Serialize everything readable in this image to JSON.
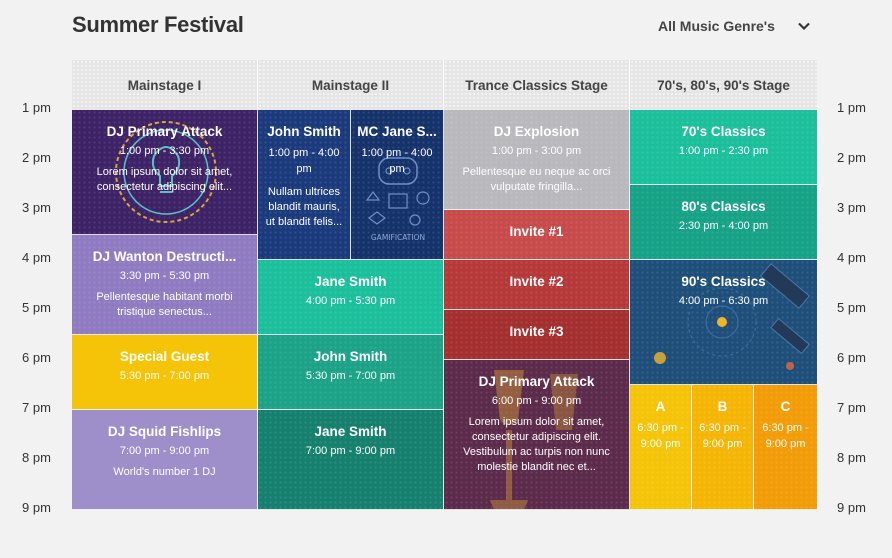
{
  "header": {
    "title": "Summer Festival",
    "genre_filter": "All Music Genre's"
  },
  "times": [
    "1 pm",
    "2 pm",
    "3 pm",
    "4 pm",
    "5 pm",
    "6 pm",
    "7 pm",
    "8 pm",
    "9 pm"
  ],
  "stages": [
    "Mainstage I",
    "Mainstage II",
    "Trance Classics Stage",
    "70's, 80's, 90's Stage"
  ],
  "events": [
    {
      "name": "DJ Primary Attack",
      "time": "1:00 pm - 3:30 pm",
      "desc": "Lorem ipsum dolor sit amet, consectetur adipiscing elit...",
      "color": "#3d2266"
    },
    {
      "name": "DJ Wanton Destructi...",
      "time": "3:30 pm - 5:30 pm",
      "desc": "Pellentesque habitant morbi tristique senectus...",
      "color": "#8e7bc2"
    },
    {
      "name": "Special Guest",
      "time": "5:30 pm - 7:00 pm",
      "desc": "",
      "color": "#f5c408"
    },
    {
      "name": "DJ Squid Fishlips",
      "time": "7:00 pm - 9:00 pm",
      "desc": "World's number 1 DJ",
      "color": "#9e8fcb"
    },
    {
      "name": "John Smith",
      "time": "1:00 pm - 4:00 pm",
      "desc": "Nullam ultrices blandit mauris, ut blandit felis...",
      "color": "#1b3a7c"
    },
    {
      "name": "MC Jane S...",
      "time": "1:00 pm - 4:00 pm",
      "desc": "",
      "color": "#16326b"
    },
    {
      "name": "Jane Smith",
      "time": "4:00 pm - 5:30 pm",
      "desc": "",
      "color": "#1bbf9b"
    },
    {
      "name": "John Smith",
      "time": "5:30 pm - 7:00 pm",
      "desc": "",
      "color": "#1ba287"
    },
    {
      "name": "Jane Smith",
      "time": "7:00 pm - 9:00 pm",
      "desc": "",
      "color": "#16806e"
    },
    {
      "name": "DJ Explosion",
      "time": "1:00 pm - 3:00 pm",
      "desc": "Pellentesque eu neque ac orci vulputate fringilla...",
      "color": "#b9b9bd"
    },
    {
      "name": "Invite #1",
      "time": "",
      "desc": "",
      "color": "#c74b4b"
    },
    {
      "name": "Invite #2",
      "time": "",
      "desc": "",
      "color": "#b63939"
    },
    {
      "name": "Invite #3",
      "time": "",
      "desc": "",
      "color": "#a42f2f"
    },
    {
      "name": "DJ Primary Attack",
      "time": "6:00 pm - 9:00 pm",
      "desc": "Lorem ipsum dolor sit amet, consectetur adipiscing elit. Vestibulum ac turpis non nunc molestie blandit nec et...",
      "color": "#5c2a4a"
    },
    {
      "name": "70's Classics",
      "time": "1:00 pm - 2:30 pm",
      "desc": "",
      "color": "#1bbf9b"
    },
    {
      "name": "80's Classics",
      "time": "2:30 pm - 4:00 pm",
      "desc": "",
      "color": "#16a286"
    },
    {
      "name": "90's Classics",
      "time": "4:00 pm - 6:30 pm",
      "desc": "",
      "color": "#1e4f7a"
    },
    {
      "name": "A",
      "time": "6:30 pm - 9:00 pm",
      "desc": "",
      "color": "#f5c408"
    },
    {
      "name": "B",
      "time": "6:30 pm - 9:00 pm",
      "desc": "",
      "color": "#f5b505"
    },
    {
      "name": "C",
      "time": "6:30 pm - 9:00 pm",
      "desc": "",
      "color": "#f29c07"
    }
  ]
}
